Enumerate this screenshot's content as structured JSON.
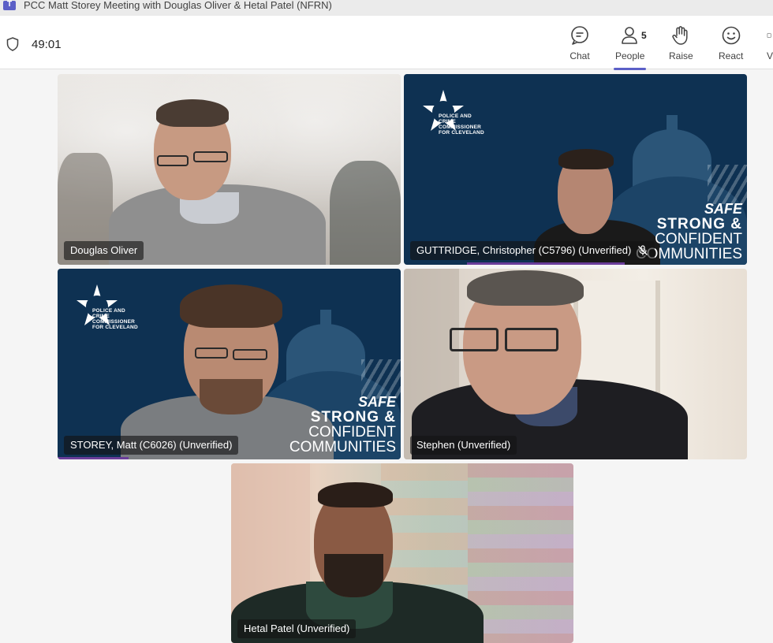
{
  "window": {
    "title": "PCC Matt Storey Meeting with Douglas Oliver & Hetal Patel (NFRN)"
  },
  "topbar": {
    "timer": "49:01",
    "chat_label": "Chat",
    "people_label": "People",
    "people_count": "5",
    "raise_label": "Raise",
    "react_label": "React",
    "view_label": "V"
  },
  "tiles": [
    {
      "name": "Douglas Oliver",
      "muted": false
    },
    {
      "name": "GUTTRIDGE, Christopher (C5796) (Unverified)",
      "muted": true
    },
    {
      "name": "STOREY, Matt (C6026) (Unverified)",
      "muted": false
    },
    {
      "name": "Stephen (Unverified)",
      "muted": false
    },
    {
      "name": "Hetal Patel (Unverified)",
      "muted": false
    }
  ],
  "background_branding": {
    "logo_text": "POLICE AND CRIME COMMISSIONER FOR CLEVELAND",
    "slogan_line1": "SAFE",
    "slogan_line2": "STRONG &",
    "slogan_line3": "CONFIDENT",
    "slogan_line4": "COMMUNITIES"
  },
  "colors": {
    "accent": "#5b5fc7",
    "pcc_navy": "#0e3152",
    "active_tab_underline": "#5b5fc7"
  }
}
